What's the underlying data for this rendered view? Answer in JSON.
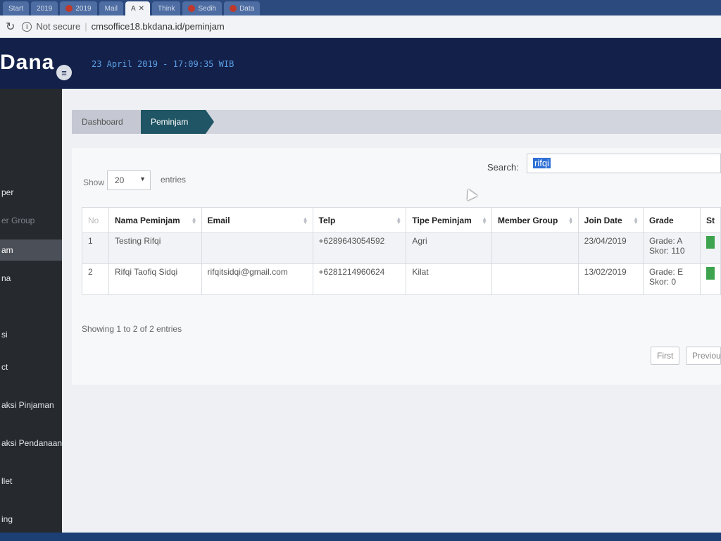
{
  "browser": {
    "tabs": [
      "Start",
      "2019",
      "2019",
      "Mail",
      "A",
      "Think",
      "Sedih",
      "Data"
    ],
    "active_tab_index": 4,
    "address": {
      "security": "Not secure",
      "url": "cmsoffice18.bkdana.id/peminjam"
    }
  },
  "header": {
    "logo": "Dana",
    "datetime": "23 April 2019 - 17:09:35 WIB"
  },
  "sidebar": {
    "items": [
      {
        "label": "per"
      },
      {
        "label": "er Group"
      },
      {
        "label": "am"
      },
      {
        "label": "na"
      },
      {
        "label": "si"
      },
      {
        "label": "ct"
      },
      {
        "label": "aksi Pinjaman"
      },
      {
        "label": "aksi Pendanaan"
      },
      {
        "label": "llet"
      },
      {
        "label": "ing"
      }
    ],
    "active_index": 2
  },
  "breadcrumb": {
    "items": [
      "Dashboard",
      "Peminjam"
    ]
  },
  "table_controls": {
    "show_label": "Show",
    "page_size": "20",
    "entries_label": "entries",
    "search_label": "Search:",
    "search_value": "rifqi"
  },
  "table": {
    "columns": [
      "No",
      "Nama Peminjam",
      "Email",
      "Telp",
      "Tipe Peminjam",
      "Member Group",
      "Join Date",
      "Grade",
      "St"
    ],
    "rows": [
      {
        "no": "1",
        "nama": "Testing Rifqi",
        "email": "",
        "telp": "+6289643054592",
        "tipe": "Agri",
        "member_group": "",
        "join_date": "23/04/2019",
        "grade": "Grade: A",
        "skor": "Skor: 110"
      },
      {
        "no": "2",
        "nama": "Rifqi Taofiq Sidqi",
        "email": "rifqitsidqi@gmail.com",
        "telp": "+6281214960624",
        "tipe": "Kilat",
        "member_group": "",
        "join_date": "13/02/2019",
        "grade": "Grade: E",
        "skor": "Skor: 0"
      }
    ]
  },
  "info": "Showing 1 to 2 of 2 entries",
  "pagination": {
    "first": "First",
    "previous": "Previous"
  },
  "icons": {
    "menu": "hamburger-icon",
    "reload": "reload-icon",
    "info": "info-icon",
    "caret": "caret-down-icon",
    "sort": "sort-icon"
  },
  "colors": {
    "header": "#13214a",
    "sidebar": "#26292e",
    "breadcrumb_active": "#1f5564",
    "status_badge": "#3ea34f",
    "search_highlight": "#2f6fd6"
  }
}
